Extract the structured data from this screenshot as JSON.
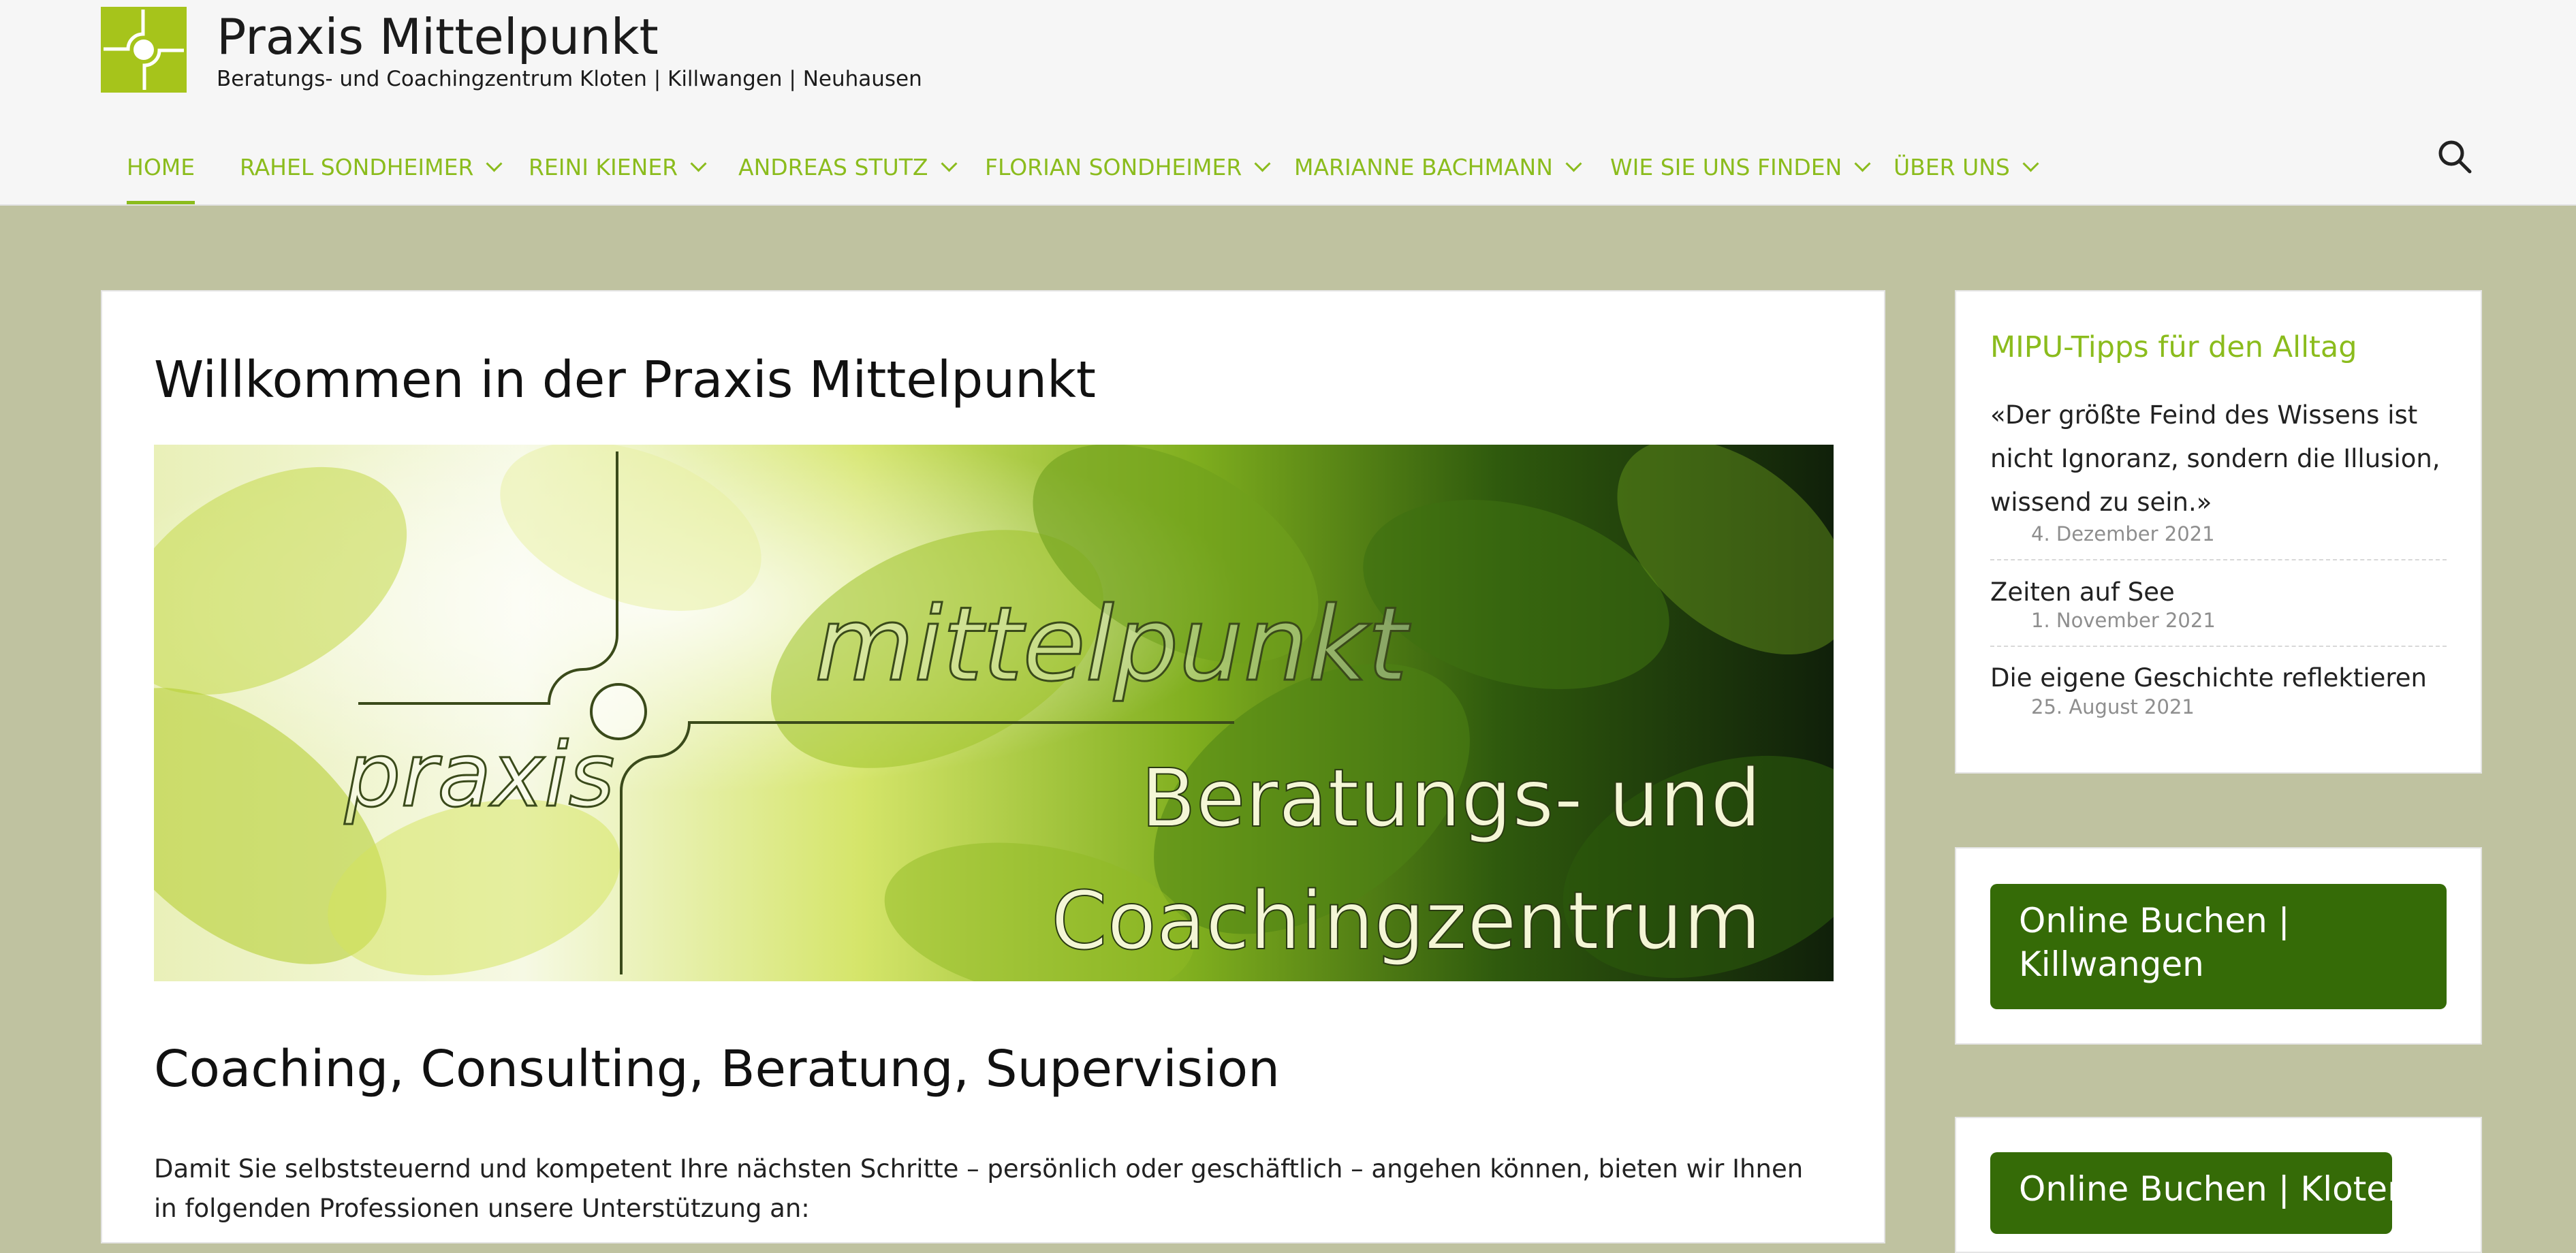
{
  "site": {
    "title": "Praxis Mittelpunkt",
    "tagline": "Beratungs- und Coachingzentrum Kloten | Killwangen | Neuhausen",
    "logo_icon": "mittelpunkt-logo-icon"
  },
  "nav": {
    "items": [
      {
        "label": "HOME",
        "active": true,
        "dropdown": false
      },
      {
        "label": "RAHEL SONDHEIMER",
        "dropdown": true
      },
      {
        "label": "REINI KIENER",
        "dropdown": true
      },
      {
        "label": "ANDREAS STUTZ",
        "dropdown": true
      },
      {
        "label": "FLORIAN SONDHEIMER",
        "dropdown": true
      },
      {
        "label": "MARIANNE BACHMANN",
        "dropdown": true
      },
      {
        "label": "WIE SIE UNS FINDEN",
        "dropdown": true
      },
      {
        "label": "ÜBER UNS",
        "dropdown": true
      }
    ],
    "search_icon": "search-icon"
  },
  "main": {
    "page_title": "Willkommen in der Praxis Mittelpunkt",
    "hero": {
      "logo_word_praxis": "praxis",
      "logo_word_mittelpunkt": "mittelpunkt",
      "caption_line1": "Beratungs- und",
      "caption_line2": "Coachingzentrum"
    },
    "section_heading": "Coaching, Consulting, Beratung, Supervision",
    "intro_text": "Damit Sie selbststeuernd und kompetent Ihre nächsten Schritte – persönlich oder geschäftlich – angehen können, bieten wir Ihnen in folgenden Professionen unsere Unterstützung an:"
  },
  "sidebar": {
    "tips": {
      "title": "MIPU-Tipps für den Alltag",
      "posts": [
        {
          "title": "«Der größte Feind des Wissens ist nicht Ignoranz, sondern die Illusion, wissend zu sein.»",
          "date": "4. Dezember 2021"
        },
        {
          "title": "Zeiten auf See",
          "date": "1. November 2021"
        },
        {
          "title": "Die eigene Geschichte reflektieren",
          "date": "25. August 2021"
        }
      ]
    },
    "booking": {
      "killwangen_label": "Online Buchen | Killwangen",
      "kloten_label": "Online Buchen | Kloten"
    }
  },
  "colors": {
    "accent": "#8bbc1d",
    "page_background": "#bfc2a0",
    "button": "#356b07",
    "logo": "#a6c41b"
  }
}
